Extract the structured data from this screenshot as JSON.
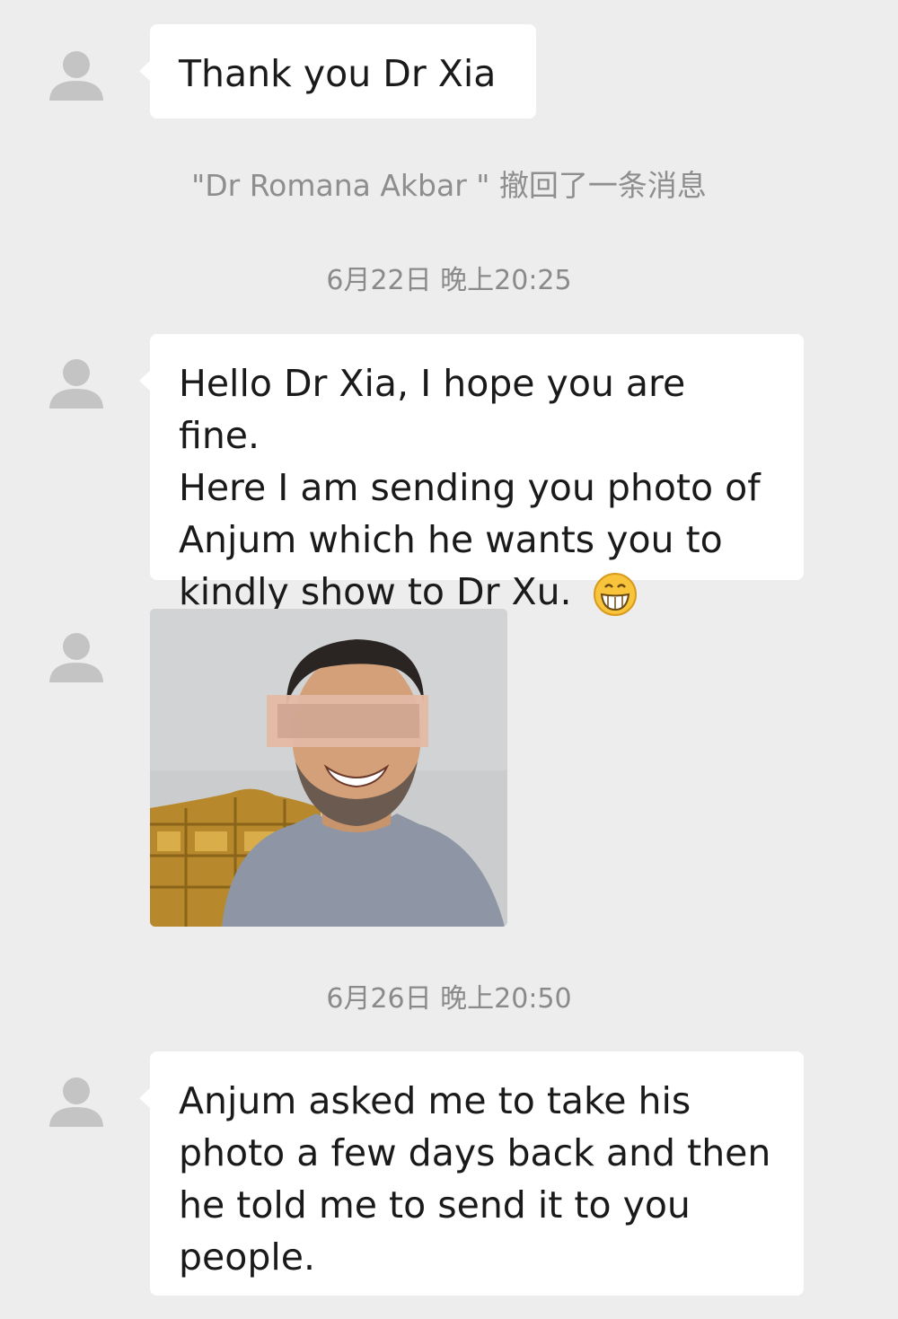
{
  "messages": [
    {
      "text": "Thank you Dr Xia"
    },
    {
      "lines": [
        "Hello Dr Xia, I hope you are fine.",
        "Here I am sending you photo of",
        "Anjum which he wants you to",
        "kindly show to Dr Xu."
      ],
      "emoji": "grinning-face-emoji"
    },
    {
      "lines": [
        "Anjum asked me to take his",
        "photo a few days back and then",
        "he told me to send it to you",
        "people."
      ]
    }
  ],
  "system_notice": "\"Dr Romana Akbar \" 撤回了一条消息",
  "timestamps": [
    "6月22日 晚上20:25",
    "6月26日 晚上20:50"
  ],
  "colors": {
    "background": "#ededed",
    "bubble": "#ffffff",
    "avatar": "#c4c4c4",
    "meta_text": "#8a8a8a"
  }
}
